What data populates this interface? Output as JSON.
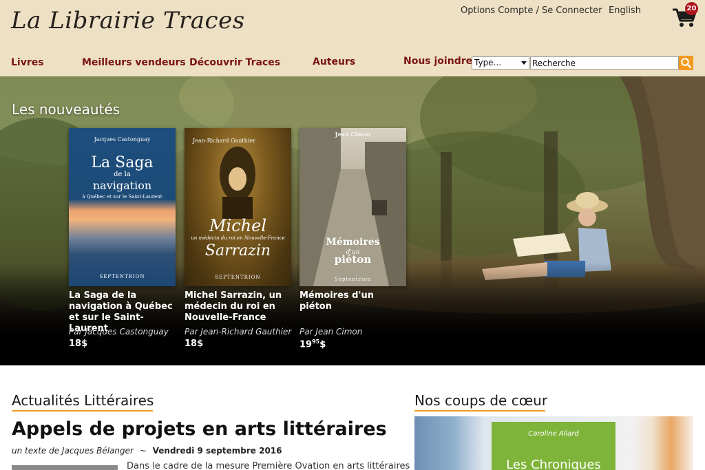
{
  "header": {
    "logo": "La Librairie Traces",
    "account_link": "Options Compte / Se Connecter",
    "language_link": "English",
    "cart_count": "20"
  },
  "nav": {
    "items": [
      {
        "label": "Livres"
      },
      {
        "label": "Meilleurs vendeurs"
      },
      {
        "label": "Découvrir Traces"
      },
      {
        "label": "Auteurs"
      },
      {
        "label": "Nous joindre"
      }
    ]
  },
  "search": {
    "type_select_value": "Type...",
    "input_value": "Recherche"
  },
  "hero": {
    "title": "Les nouveautés",
    "books": [
      {
        "title": "La Saga de la navigation à Québec et sur le Saint-Laurent",
        "author": "Par Jacques Castonguay",
        "price": "18$",
        "cover_author": "Jacques Castonguay",
        "cover_title_1": "La Saga",
        "cover_title_2": "de la",
        "cover_title_3": "navigation",
        "cover_subtitle": "à Québec et sur le Saint-Laurent",
        "cover_publisher": "SEPTENTRION"
      },
      {
        "title": "Michel Sarrazin, un médecin du roi en Nouvelle-France",
        "author": "Par Jean-Richard Gauthier",
        "price": "18$",
        "cover_author": "Jean-Richard Gauthier",
        "cover_title_1": "Michel",
        "cover_subtitle": "un médecin du roi en Nouvelle-France",
        "cover_title_2": "Sarrazin",
        "cover_publisher": "SEPTENTRION"
      },
      {
        "title": "Mémoires d'un piéton",
        "author": "Par Jean Cimon",
        "price_main": "19",
        "price_cents": "95",
        "price_suffix": "$",
        "cover_author": "Jean Cimon",
        "cover_title_1": "Mémoires",
        "cover_title_2": "d'un",
        "cover_title_3": "piéton",
        "cover_publisher": "Septentrion"
      }
    ]
  },
  "news": {
    "heading": "Actualités Littéraires",
    "article_title": "Appels de projets en arts littéraires",
    "byline_author": "un texte de Jacques Bélanger",
    "byline_sep": "~",
    "byline_date": "Vendredi 9 septembre 2016",
    "excerpt": "Dans le cadre de la mesure Première Ovation en arts littéraires"
  },
  "coups": {
    "heading": "Nos coups de cœur",
    "book_author": "Caroline Allard",
    "book_title": "Les Chroniques"
  },
  "colors": {
    "header_bg": "#ede0c4",
    "nav_text": "#7a1313",
    "accent": "#f39a1e",
    "cart_badge": "#b0151b"
  }
}
